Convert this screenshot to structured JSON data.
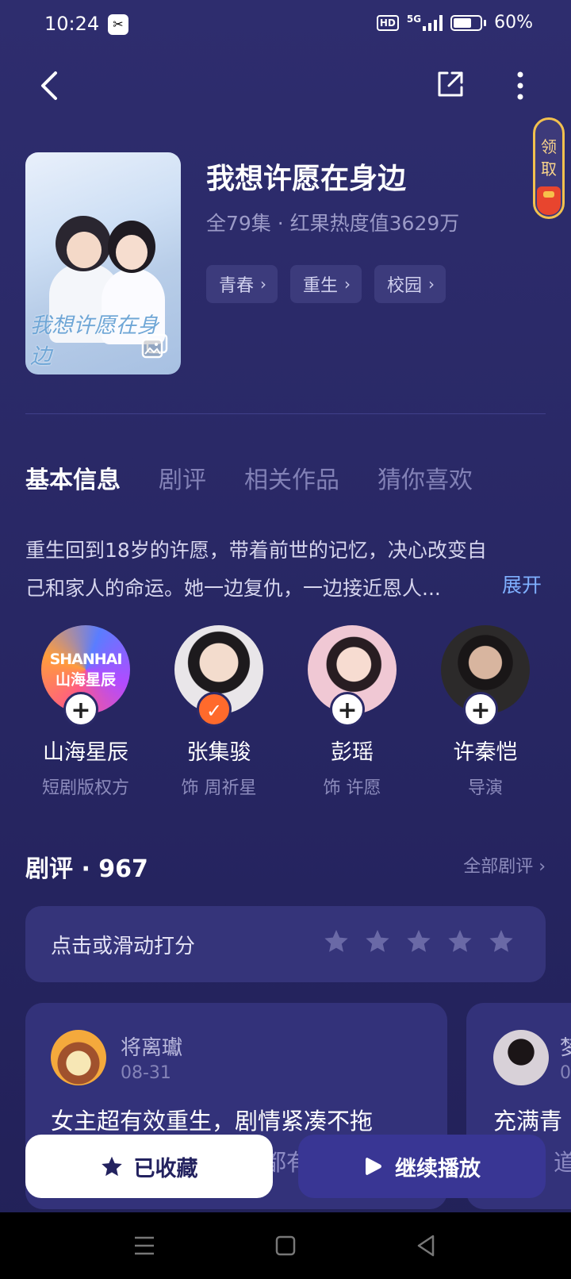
{
  "status_bar": {
    "time": "10:24",
    "app_icon": "capcut-icon",
    "hd": "HD",
    "network": "5G",
    "battery": "60%"
  },
  "top_bar": {
    "back_icon": "chevron-left-icon",
    "share_icon": "share-icon",
    "more_icon": "more-vertical-icon"
  },
  "claim_widget": {
    "label": "领取"
  },
  "drama": {
    "poster_calligraphy": "我想许愿在身边",
    "title": "我想许愿在身边",
    "meta": "全79集 · 红果热度值3629万",
    "tags": [
      {
        "label": "青春"
      },
      {
        "label": "重生"
      },
      {
        "label": "校园"
      }
    ]
  },
  "tabs": [
    {
      "label": "基本信息",
      "active": true
    },
    {
      "label": "剧评"
    },
    {
      "label": "相关作品"
    },
    {
      "label": "猜你喜欢"
    }
  ],
  "synopsis": {
    "text": "重生回到18岁的许愿，带着前世的记忆，决心改变自己和家人的命运。她一边复仇，一边接近恩人...",
    "expand_label": "展开"
  },
  "cast": [
    {
      "name": "山海星辰",
      "role": "短剧版权方",
      "logo_line1": "SHANHAI",
      "logo_line2": "山海星辰",
      "followed": false
    },
    {
      "name": "张集骏",
      "role": "饰 周祈星",
      "followed": true
    },
    {
      "name": "彭瑶",
      "role": "饰 许愿",
      "followed": false
    },
    {
      "name": "许秦恺",
      "role": "导演",
      "followed": false
    }
  ],
  "reviews": {
    "title": "剧评 · 967",
    "all_label": "全部剧评 ›",
    "rate_prompt": "点击或滑动打分",
    "star_count": 5,
    "items": [
      {
        "user": "将离瓛",
        "date": "08-31",
        "text": "女主超有效重生，剧情紧凑不拖",
        "text2": "都有"
      },
      {
        "user": "梦",
        "date": "0",
        "text": "充满青",
        "text2": "道"
      }
    ]
  },
  "actions": {
    "favorite_label": "已收藏",
    "play_label": "继续播放"
  },
  "colors": {
    "background": "#2a2967",
    "accent": "#7fb0ff",
    "followed": "#ff6a2c",
    "play_button": "#393694"
  }
}
